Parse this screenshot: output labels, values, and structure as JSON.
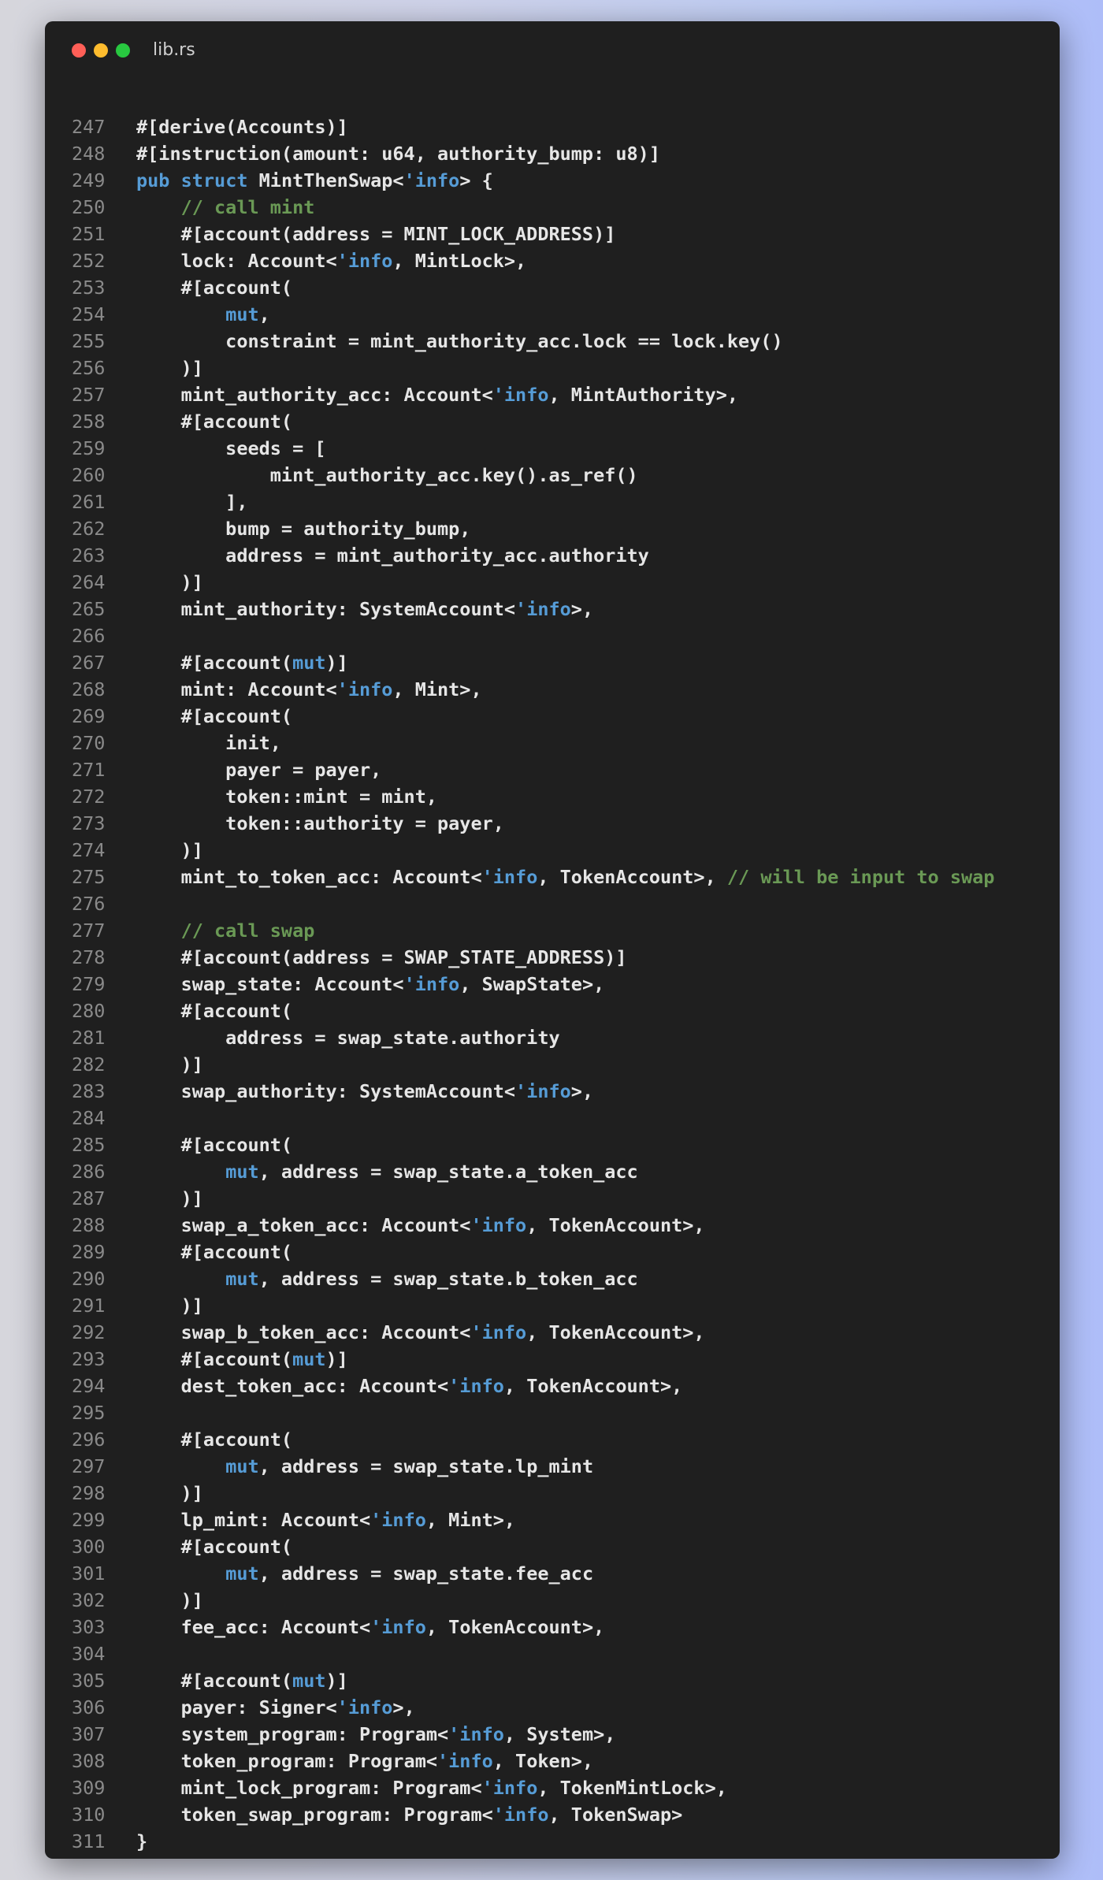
{
  "window": {
    "title": "lib.rs",
    "traffic_lights": [
      "close",
      "minimize",
      "zoom"
    ]
  },
  "colors": {
    "background": "#1f1f1f",
    "text": "#e6e6e6",
    "keyword": "#569cd6",
    "comment": "#6a9955",
    "line_number": "#8a8a8a"
  },
  "code": {
    "language": "rust",
    "lines": [
      {
        "n": "247",
        "tokens": [
          [
            "",
            "#[derive(Accounts)]"
          ]
        ]
      },
      {
        "n": "248",
        "tokens": [
          [
            "",
            "#[instruction(amount: u64, authority_bump: u8)]"
          ]
        ]
      },
      {
        "n": "249",
        "tokens": [
          [
            "k",
            "pub"
          ],
          [
            "",
            " "
          ],
          [
            "k",
            "struct"
          ],
          [
            "",
            " MintThenSwap<"
          ],
          [
            "k",
            "'info"
          ],
          [
            "",
            "> {"
          ]
        ]
      },
      {
        "n": "250",
        "tokens": [
          [
            "",
            "    "
          ],
          [
            "c",
            "// call mint"
          ]
        ]
      },
      {
        "n": "251",
        "tokens": [
          [
            "",
            "    #[account(address = MINT_LOCK_ADDRESS)]"
          ]
        ]
      },
      {
        "n": "252",
        "tokens": [
          [
            "",
            "    lock: Account<"
          ],
          [
            "k",
            "'info"
          ],
          [
            "",
            ", MintLock>,"
          ]
        ]
      },
      {
        "n": "253",
        "tokens": [
          [
            "",
            "    #[account("
          ]
        ]
      },
      {
        "n": "254",
        "tokens": [
          [
            "",
            "        "
          ],
          [
            "k",
            "mut"
          ],
          [
            "",
            ","
          ]
        ]
      },
      {
        "n": "255",
        "tokens": [
          [
            "",
            "        constraint = mint_authority_acc.lock == lock.key()"
          ]
        ]
      },
      {
        "n": "256",
        "tokens": [
          [
            "",
            "    )]"
          ]
        ]
      },
      {
        "n": "257",
        "tokens": [
          [
            "",
            "    mint_authority_acc: Account<"
          ],
          [
            "k",
            "'info"
          ],
          [
            "",
            ", MintAuthority>,"
          ]
        ]
      },
      {
        "n": "258",
        "tokens": [
          [
            "",
            "    #[account("
          ]
        ]
      },
      {
        "n": "259",
        "tokens": [
          [
            "",
            "        seeds = ["
          ]
        ]
      },
      {
        "n": "260",
        "tokens": [
          [
            "",
            "            mint_authority_acc.key().as_ref()"
          ]
        ]
      },
      {
        "n": "261",
        "tokens": [
          [
            "",
            "        ],"
          ]
        ]
      },
      {
        "n": "262",
        "tokens": [
          [
            "",
            "        bump = authority_bump,"
          ]
        ]
      },
      {
        "n": "263",
        "tokens": [
          [
            "",
            "        address = mint_authority_acc.authority"
          ]
        ]
      },
      {
        "n": "264",
        "tokens": [
          [
            "",
            "    )]"
          ]
        ]
      },
      {
        "n": "265",
        "tokens": [
          [
            "",
            "    mint_authority: SystemAccount<"
          ],
          [
            "k",
            "'info"
          ],
          [
            "",
            ">,"
          ]
        ]
      },
      {
        "n": "266",
        "tokens": []
      },
      {
        "n": "267",
        "tokens": [
          [
            "",
            "    #[account("
          ],
          [
            "k",
            "mut"
          ],
          [
            "",
            ")]"
          ]
        ]
      },
      {
        "n": "268",
        "tokens": [
          [
            "",
            "    mint: Account<"
          ],
          [
            "k",
            "'info"
          ],
          [
            "",
            ", Mint>,"
          ]
        ]
      },
      {
        "n": "269",
        "tokens": [
          [
            "",
            "    #[account("
          ]
        ]
      },
      {
        "n": "270",
        "tokens": [
          [
            "",
            "        init,"
          ]
        ]
      },
      {
        "n": "271",
        "tokens": [
          [
            "",
            "        payer = payer,"
          ]
        ]
      },
      {
        "n": "272",
        "tokens": [
          [
            "",
            "        token::mint = mint,"
          ]
        ]
      },
      {
        "n": "273",
        "tokens": [
          [
            "",
            "        token::authority = payer,"
          ]
        ]
      },
      {
        "n": "274",
        "tokens": [
          [
            "",
            "    )]"
          ]
        ]
      },
      {
        "n": "275",
        "tokens": [
          [
            "",
            "    mint_to_token_acc: Account<"
          ],
          [
            "k",
            "'info"
          ],
          [
            "",
            ", TokenAccount>, "
          ],
          [
            "c",
            "// will be input to swap"
          ]
        ]
      },
      {
        "n": "276",
        "tokens": []
      },
      {
        "n": "277",
        "tokens": [
          [
            "",
            "    "
          ],
          [
            "c",
            "// call swap"
          ]
        ]
      },
      {
        "n": "278",
        "tokens": [
          [
            "",
            "    #[account(address = SWAP_STATE_ADDRESS)]"
          ]
        ]
      },
      {
        "n": "279",
        "tokens": [
          [
            "",
            "    swap_state: Account<"
          ],
          [
            "k",
            "'info"
          ],
          [
            "",
            ", SwapState>,"
          ]
        ]
      },
      {
        "n": "280",
        "tokens": [
          [
            "",
            "    #[account("
          ]
        ]
      },
      {
        "n": "281",
        "tokens": [
          [
            "",
            "        address = swap_state.authority"
          ]
        ]
      },
      {
        "n": "282",
        "tokens": [
          [
            "",
            "    )]"
          ]
        ]
      },
      {
        "n": "283",
        "tokens": [
          [
            "",
            "    swap_authority: SystemAccount<"
          ],
          [
            "k",
            "'info"
          ],
          [
            "",
            ">,"
          ]
        ]
      },
      {
        "n": "284",
        "tokens": []
      },
      {
        "n": "285",
        "tokens": [
          [
            "",
            "    #[account("
          ]
        ]
      },
      {
        "n": "286",
        "tokens": [
          [
            "",
            "        "
          ],
          [
            "k",
            "mut"
          ],
          [
            "",
            ", address = swap_state.a_token_acc"
          ]
        ]
      },
      {
        "n": "287",
        "tokens": [
          [
            "",
            "    )]"
          ]
        ]
      },
      {
        "n": "288",
        "tokens": [
          [
            "",
            "    swap_a_token_acc: Account<"
          ],
          [
            "k",
            "'info"
          ],
          [
            "",
            ", TokenAccount>,"
          ]
        ]
      },
      {
        "n": "289",
        "tokens": [
          [
            "",
            "    #[account("
          ]
        ]
      },
      {
        "n": "290",
        "tokens": [
          [
            "",
            "        "
          ],
          [
            "k",
            "mut"
          ],
          [
            "",
            ", address = swap_state.b_token_acc"
          ]
        ]
      },
      {
        "n": "291",
        "tokens": [
          [
            "",
            "    )]"
          ]
        ]
      },
      {
        "n": "292",
        "tokens": [
          [
            "",
            "    swap_b_token_acc: Account<"
          ],
          [
            "k",
            "'info"
          ],
          [
            "",
            ", TokenAccount>,"
          ]
        ]
      },
      {
        "n": "293",
        "tokens": [
          [
            "",
            "    #[account("
          ],
          [
            "k",
            "mut"
          ],
          [
            "",
            ")]"
          ]
        ]
      },
      {
        "n": "294",
        "tokens": [
          [
            "",
            "    dest_token_acc: Account<"
          ],
          [
            "k",
            "'info"
          ],
          [
            "",
            ", TokenAccount>,"
          ]
        ]
      },
      {
        "n": "295",
        "tokens": []
      },
      {
        "n": "296",
        "tokens": [
          [
            "",
            "    #[account("
          ]
        ]
      },
      {
        "n": "297",
        "tokens": [
          [
            "",
            "        "
          ],
          [
            "k",
            "mut"
          ],
          [
            "",
            ", address = swap_state.lp_mint"
          ]
        ]
      },
      {
        "n": "298",
        "tokens": [
          [
            "",
            "    )]"
          ]
        ]
      },
      {
        "n": "299",
        "tokens": [
          [
            "",
            "    lp_mint: Account<"
          ],
          [
            "k",
            "'info"
          ],
          [
            "",
            ", Mint>,"
          ]
        ]
      },
      {
        "n": "300",
        "tokens": [
          [
            "",
            "    #[account("
          ]
        ]
      },
      {
        "n": "301",
        "tokens": [
          [
            "",
            "        "
          ],
          [
            "k",
            "mut"
          ],
          [
            "",
            ", address = swap_state.fee_acc"
          ]
        ]
      },
      {
        "n": "302",
        "tokens": [
          [
            "",
            "    )]"
          ]
        ]
      },
      {
        "n": "303",
        "tokens": [
          [
            "",
            "    fee_acc: Account<"
          ],
          [
            "k",
            "'info"
          ],
          [
            "",
            ", TokenAccount>,"
          ]
        ]
      },
      {
        "n": "304",
        "tokens": []
      },
      {
        "n": "305",
        "tokens": [
          [
            "",
            "    #[account("
          ],
          [
            "k",
            "mut"
          ],
          [
            "",
            ")]"
          ]
        ]
      },
      {
        "n": "306",
        "tokens": [
          [
            "",
            "    payer: Signer<"
          ],
          [
            "k",
            "'info"
          ],
          [
            "",
            ">,"
          ]
        ]
      },
      {
        "n": "307",
        "tokens": [
          [
            "",
            "    system_program: Program<"
          ],
          [
            "k",
            "'info"
          ],
          [
            "",
            ", System>,"
          ]
        ]
      },
      {
        "n": "308",
        "tokens": [
          [
            "",
            "    token_program: Program<"
          ],
          [
            "k",
            "'info"
          ],
          [
            "",
            ", Token>,"
          ]
        ]
      },
      {
        "n": "309",
        "tokens": [
          [
            "",
            "    mint_lock_program: Program<"
          ],
          [
            "k",
            "'info"
          ],
          [
            "",
            ", TokenMintLock>,"
          ]
        ]
      },
      {
        "n": "310",
        "tokens": [
          [
            "",
            "    token_swap_program: Program<"
          ],
          [
            "k",
            "'info"
          ],
          [
            "",
            ", TokenSwap>"
          ]
        ]
      },
      {
        "n": "311",
        "tokens": [
          [
            "",
            "}"
          ]
        ]
      }
    ]
  }
}
